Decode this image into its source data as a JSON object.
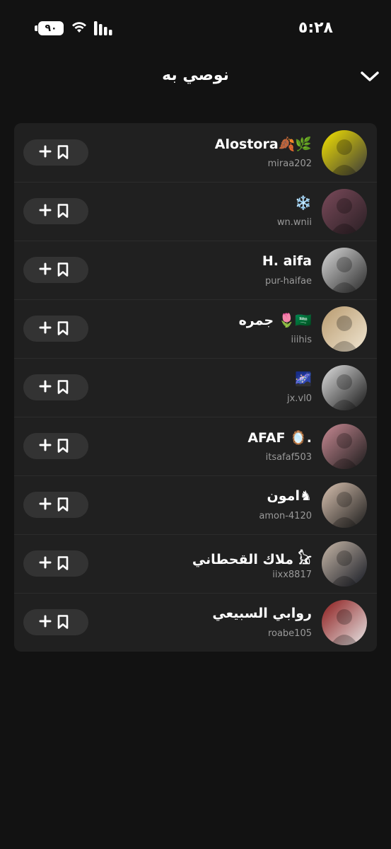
{
  "status": {
    "time": "٥:٢٨",
    "battery": "٩٠"
  },
  "header": {
    "title": "نوصي به"
  },
  "users": [
    {
      "name": "Alostora🍂🌿",
      "handle": "miraa202",
      "avatar_colors": [
        "#f5e300",
        "#3a3a3a"
      ],
      "avatar_icon": "bitmoji-icon"
    },
    {
      "name": "❄️",
      "handle": "wn.wnii",
      "avatar_colors": [
        "#7a4a5a",
        "#2a1f24"
      ],
      "avatar_icon": "photo-icon"
    },
    {
      "name": "H. aifa",
      "handle": "pur-haifae",
      "avatar_colors": [
        "#d8d8d8",
        "#2a2a2a"
      ],
      "avatar_icon": "photo-icon"
    },
    {
      "name": "جمره 🌷🇸🇦",
      "handle": "iiihis",
      "avatar_colors": [
        "#b89a6e",
        "#f0e6d2"
      ],
      "avatar_icon": "emblem-icon"
    },
    {
      "name": "🌌",
      "handle": "jx.vl0",
      "avatar_colors": [
        "#e0e0e0",
        "#151515"
      ],
      "avatar_icon": "photo-icon"
    },
    {
      "name": "AFAF 🪞.",
      "handle": "itsafaf503",
      "avatar_colors": [
        "#c98a94",
        "#1b1b1b"
      ],
      "avatar_icon": "photo-icon"
    },
    {
      "name": "امون♞",
      "handle": "amon-4120",
      "avatar_colors": [
        "#d9c2b0",
        "#1c1c1c"
      ],
      "avatar_icon": "photo-icon"
    },
    {
      "name": "ملاك القحطاني 𓃠",
      "handle": "iixx8817",
      "avatar_colors": [
        "#c8b8a8",
        "#161a24"
      ],
      "avatar_icon": "photo-icon"
    },
    {
      "name": "روابي السبيعي",
      "handle": "roabe105",
      "avatar_colors": [
        "#8c1a1a",
        "#e6e6e6"
      ],
      "avatar_icon": "photo-icon"
    }
  ],
  "colors": {
    "background": "#121212",
    "card": "#202020",
    "button": "#333333",
    "muted": "#9a9a9a"
  }
}
